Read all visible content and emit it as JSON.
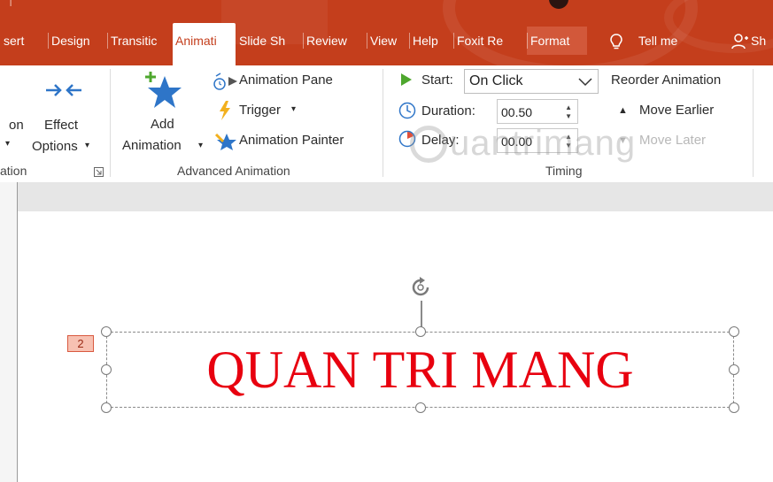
{
  "tabs": {
    "insert": "sert",
    "design": "Design",
    "transitions": "Transitic",
    "animations": "Animati",
    "slideshow": "Slide Sh",
    "review": "Review",
    "view": "View",
    "help": "Help",
    "foxit": "Foxit Re",
    "format": "Format",
    "tell_me": "Tell me",
    "share": "Sh"
  },
  "ribbon": {
    "animation_group": {
      "partial_label_1": "on",
      "effect_options_line1": "Effect",
      "effect_options_line2": "Options",
      "label": "ation"
    },
    "advanced_animation": {
      "add_line1": "Add",
      "add_line2": "Animation",
      "animation_pane": "Animation Pane",
      "trigger": "Trigger",
      "animation_painter": "Animation Painter",
      "label": "Advanced Animation"
    },
    "timing": {
      "start_label": "Start:",
      "start_value": "On Click",
      "duration_label": "Duration:",
      "duration_value": "00.50",
      "delay_label": "Delay:",
      "delay_value": "00.00",
      "reorder_title": "Reorder Animation",
      "move_earlier": "Move Earlier",
      "move_later": "Move Later",
      "label": "Timing"
    },
    "watermark": "uantrimang"
  },
  "slide": {
    "animation_number": "2",
    "text": "QUAN TRI MANG",
    "text_color": "#e8000f"
  },
  "colors": {
    "accent": "#c43e1c",
    "icon_blue": "#2e75c8"
  }
}
